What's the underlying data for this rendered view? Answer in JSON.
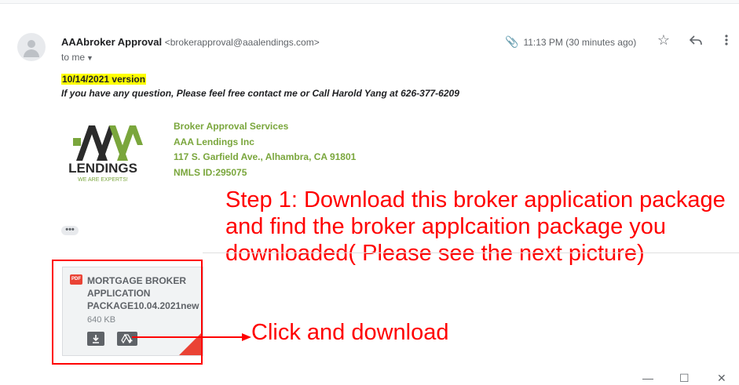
{
  "email": {
    "sender_name": "AAAbroker Approval",
    "sender_email": "<brokerapproval@aaalendings.com>",
    "to_me": "to me",
    "time": "11:13 PM (30 minutes ago)"
  },
  "body": {
    "version": "10/14/2021 version",
    "question": "If you have any question, Please feel free contact me  or Call Harold Yang at 626-377-6209"
  },
  "logo": {
    "word": "LENDINGS",
    "tagline": "WE ARE EXPERTS!"
  },
  "signature": {
    "line1": "Broker Approval Services",
    "line2": "AAA Lendings Inc",
    "line3": "117 S. Garfield Ave., Alhambra, CA 91801",
    "line4": "NMLS ID:295075"
  },
  "ellipsis": "•••",
  "attachment": {
    "badge": "PDF",
    "name": "MORTGAGE BROKER APPLICATION PACKAGE10.04.2021new",
    "size": "640 KB"
  },
  "annotations": {
    "step1": "Step 1: Download this broker application package and find the broker applcaition package you downloaded( Please see the next picture)",
    "click": "Click and download"
  },
  "icons": {
    "attachment": "paperclip-icon",
    "star": "star-icon",
    "reply": "reply-icon",
    "more": "more-vert-icon",
    "download": "download-icon",
    "drive": "add-to-drive-icon",
    "minimize": "minimize-icon",
    "maximize": "maximize-icon",
    "close": "close-icon"
  },
  "colors": {
    "annotation_red": "#ff0000",
    "signature_green": "#7aa63c",
    "highlight": "#ffff00"
  }
}
